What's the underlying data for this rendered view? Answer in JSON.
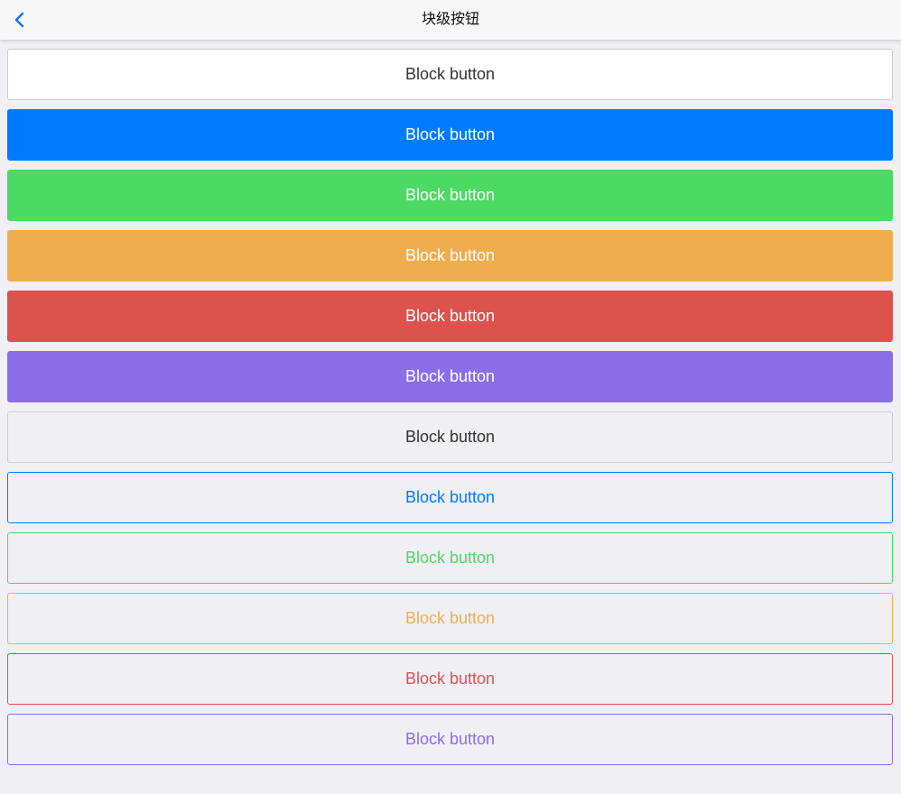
{
  "navbar": {
    "title": "块级按钮",
    "back_icon": "chevron-left-icon",
    "accent": "#007aff"
  },
  "buttons": [
    {
      "label": "Block button",
      "variant": "default",
      "bg": "#ffffff",
      "border": "#cccccc",
      "color": "#333333"
    },
    {
      "label": "Block button",
      "variant": "primary",
      "bg": "#007aff",
      "border": "#007aff",
      "color": "#ffffff"
    },
    {
      "label": "Block button",
      "variant": "success",
      "bg": "#4cd964",
      "border": "#4cd964",
      "color": "#ffffff"
    },
    {
      "label": "Block button",
      "variant": "warning",
      "bg": "#f0ad4e",
      "border": "#f0ad4e",
      "color": "#ffffff"
    },
    {
      "label": "Block button",
      "variant": "danger",
      "bg": "#dd524d",
      "border": "#dd524d",
      "color": "#ffffff"
    },
    {
      "label": "Block button",
      "variant": "royal",
      "bg": "#8a6de9",
      "border": "#8a6de9",
      "color": "#ffffff"
    },
    {
      "label": "Block button",
      "variant": "default-outlined",
      "bg": "transparent",
      "border": "#cccccc",
      "color": "#333333"
    },
    {
      "label": "Block button",
      "variant": "primary-outlined",
      "bg": "transparent",
      "border": "#007aff",
      "color": "#007aff"
    },
    {
      "label": "Block button",
      "variant": "success-outlined",
      "bg": "transparent",
      "border": "#4cd964",
      "color": "#4cd964"
    },
    {
      "label": "Block button",
      "variant": "warning-outlined",
      "bg": "transparent",
      "border": "#f0ad4e",
      "color": "#f0ad4e"
    },
    {
      "label": "Block button",
      "variant": "danger-outlined",
      "bg": "transparent",
      "border": "#dd524d",
      "color": "#dd524d"
    },
    {
      "label": "Block button",
      "variant": "royal-outlined",
      "bg": "transparent",
      "border": "#8a6de9",
      "color": "#8a6de9"
    }
  ]
}
